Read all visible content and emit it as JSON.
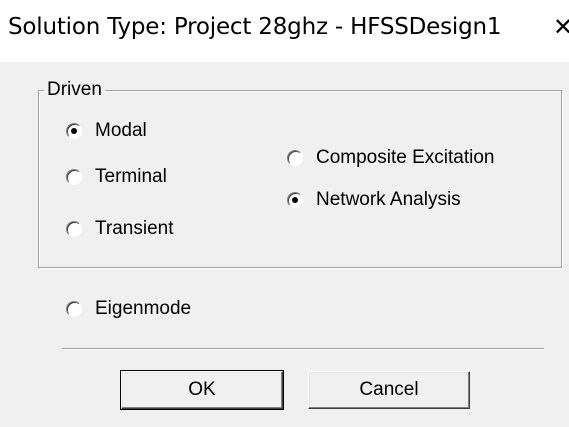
{
  "window": {
    "title": "Solution Type: Project 28ghz - HFSSDesign1",
    "close_glyph": "✕"
  },
  "driven": {
    "label": "Driven",
    "options": [
      {
        "label": "Modal",
        "checked": true
      },
      {
        "label": "Terminal",
        "checked": false
      },
      {
        "label": "Transient",
        "checked": false
      }
    ],
    "sub_options": [
      {
        "label": "Composite Excitation",
        "checked": false
      },
      {
        "label": "Network Analysis",
        "checked": true
      }
    ]
  },
  "eigenmode": {
    "label": "Eigenmode",
    "checked": false
  },
  "buttons": {
    "ok": "OK",
    "cancel": "Cancel"
  }
}
